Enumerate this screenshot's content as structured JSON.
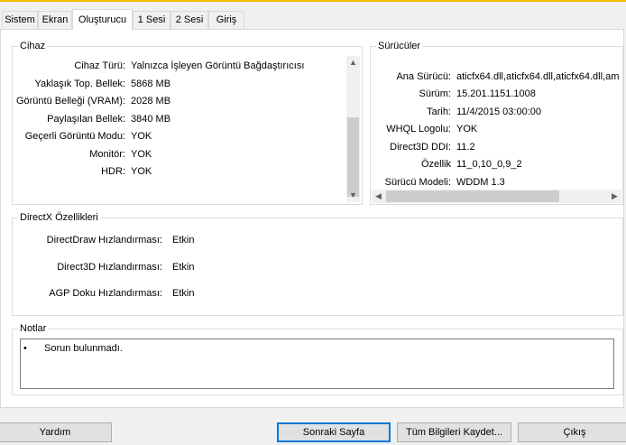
{
  "tabs": [
    "Sistem",
    "Ekran",
    "Oluşturucu",
    "1 Sesi",
    "2 Sesi",
    "Giriş"
  ],
  "active_tab": "Oluşturucu",
  "device": {
    "title": "Cihaz",
    "rows": [
      {
        "label": "Cihaz Türü:",
        "value": "Yalnızca İşleyen Görüntü Bağdaştırıcısı"
      },
      {
        "label": "Yaklaşık Top. Bellek:",
        "value": "5868 MB"
      },
      {
        "label": "Görüntü Belleği (VRAM):",
        "value": "2028 MB"
      },
      {
        "label": "Paylaşılan Bellek:",
        "value": "3840 MB"
      },
      {
        "label": "Geçerli Görüntü Modu:",
        "value": "YOK"
      },
      {
        "label": "Monitör:",
        "value": "YOK"
      },
      {
        "label": "HDR:",
        "value": "YOK"
      }
    ]
  },
  "drivers": {
    "title": "Sürücüler",
    "rows": [
      {
        "label": "Ana Sürücü:",
        "value": "aticfx64.dll,aticfx64.dll,aticfx64.dll,am"
      },
      {
        "label": "Sürüm:",
        "value": "15.201.1151.1008"
      },
      {
        "label": "Tarih:",
        "value": "11/4/2015 03:00:00"
      },
      {
        "label": "WHQL Logolu:",
        "value": "YOK"
      },
      {
        "label": "Direct3D DDI:",
        "value": "11.2"
      },
      {
        "label": "Özellik",
        "value": "11_0,10_0,9_2"
      },
      {
        "label": "Sürücü Modeli:",
        "value": "WDDM 1.3"
      }
    ]
  },
  "directx": {
    "title": "DirectX Özellikleri",
    "rows": [
      {
        "label": "DirectDraw Hızlandırması:",
        "value": "Etkin"
      },
      {
        "label": "Direct3D Hızlandırması:",
        "value": "Etkin"
      },
      {
        "label": "AGP Doku Hızlandırması:",
        "value": "Etkin"
      }
    ]
  },
  "notes": {
    "title": "Notlar",
    "items": [
      "Sorun bulunmadı."
    ]
  },
  "buttons": {
    "help": "Yardım",
    "next": "Sonraki Sayfa",
    "save_all": "Tüm Bilgileri Kaydet...",
    "exit": "Çıkış"
  },
  "icons": {
    "up": "scroll-up-arrow-icon",
    "down": "scroll-down-arrow-icon",
    "left": "scroll-left-arrow-icon",
    "right": "scroll-right-arrow-icon"
  }
}
